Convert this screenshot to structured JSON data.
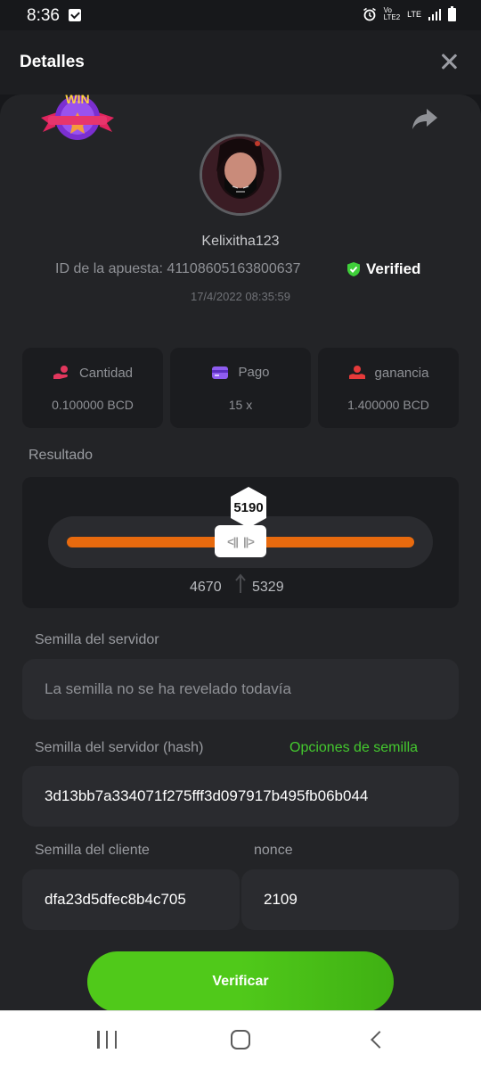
{
  "statusbar": {
    "time": "8:36",
    "network_label": "LTE"
  },
  "header": {
    "title": "Detalles"
  },
  "bet": {
    "badge_text": "WIN",
    "username": "Kelixitha123",
    "bet_id_text": "ID de la apuesta: 41108605163800637",
    "verified_label": "Verified",
    "datetime": "17/4/2022 08:35:59"
  },
  "stats": [
    {
      "label": "Cantidad",
      "value": "0.100000 BCD",
      "icon": "coins-hand-icon",
      "color": "#e2375d"
    },
    {
      "label": "Pago",
      "value": "15 x",
      "icon": "card-icon",
      "color": "#8e5cf0"
    },
    {
      "label": "ganancia",
      "value": "1.400000 BCD",
      "icon": "profit-hand-icon",
      "color": "#e53a3a"
    }
  ],
  "result": {
    "label": "Resultado",
    "value": "5190",
    "range_low": "4670",
    "range_high": "5329"
  },
  "server_seed": {
    "label": "Semilla del servidor",
    "value": "La semilla no se ha revelado todavía"
  },
  "server_seed_hash": {
    "label": "Semilla del servidor (hash)",
    "options_link": "Opciones de semilla",
    "value": "3d13bb7a334071f275fff3d097917b495fb06b044"
  },
  "client_seed": {
    "label": "Semilla del cliente",
    "value": "dfa23d5dfec8b4c705"
  },
  "nonce": {
    "label": "nonce",
    "value": "2109"
  },
  "verify_button": {
    "label": "Verificar"
  },
  "colors": {
    "accent_green": "#50c91a",
    "bar_orange": "#e86a0e",
    "panel": "#232427"
  }
}
